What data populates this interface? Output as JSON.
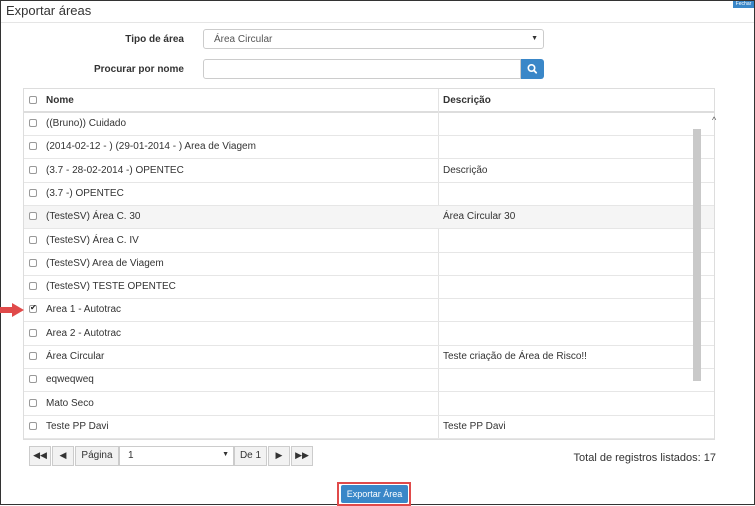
{
  "modal": {
    "title": "Exportar áreas",
    "close_label": "Fechar"
  },
  "form": {
    "tipo_label": "Tipo de área",
    "tipo_value": "Área Circular",
    "search_label": "Procurar por nome",
    "search_value": ""
  },
  "table": {
    "headers": {
      "name": "Nome",
      "desc": "Descrição"
    },
    "rows": [
      {
        "name": "((Bruno)) Cuidado",
        "desc": "",
        "checked": false
      },
      {
        "name": "(2014-02-12 - ) (29-01-2014 - ) Area de Viagem",
        "desc": "",
        "checked": false
      },
      {
        "name": "(3.7 - 28-02-2014 -) OPENTEC",
        "desc": "Descrição",
        "checked": false
      },
      {
        "name": "(3.7 -) OPENTEC",
        "desc": "",
        "checked": false
      },
      {
        "name": "(TesteSV) Área C. 30",
        "desc": "Área Circular 30",
        "checked": false
      },
      {
        "name": "(TesteSV) Área C. IV",
        "desc": "",
        "checked": false
      },
      {
        "name": "(TesteSV) Area de Viagem",
        "desc": "",
        "checked": false
      },
      {
        "name": "(TesteSV) TESTE OPENTEC",
        "desc": "",
        "checked": false
      },
      {
        "name": "Area 1 - Autotrac",
        "desc": "",
        "checked": true
      },
      {
        "name": "Area 2 - Autotrac",
        "desc": "",
        "checked": false
      },
      {
        "name": "Área Circular",
        "desc": "Teste criação de Área de Risco!!",
        "checked": false
      },
      {
        "name": "eqweqweq",
        "desc": "",
        "checked": false
      },
      {
        "name": "Mato Seco",
        "desc": "",
        "checked": false
      },
      {
        "name": "Teste PP Davi",
        "desc": "Teste PP Davi",
        "checked": false
      }
    ]
  },
  "pager": {
    "page_label": "Página",
    "page_value": "1",
    "of_label": "De 1",
    "total_text": "Total de registros listados: 17"
  },
  "actions": {
    "export_label": "Exportar Área"
  },
  "colors": {
    "primary": "#3a87c8",
    "highlight": "#e04a4a"
  }
}
